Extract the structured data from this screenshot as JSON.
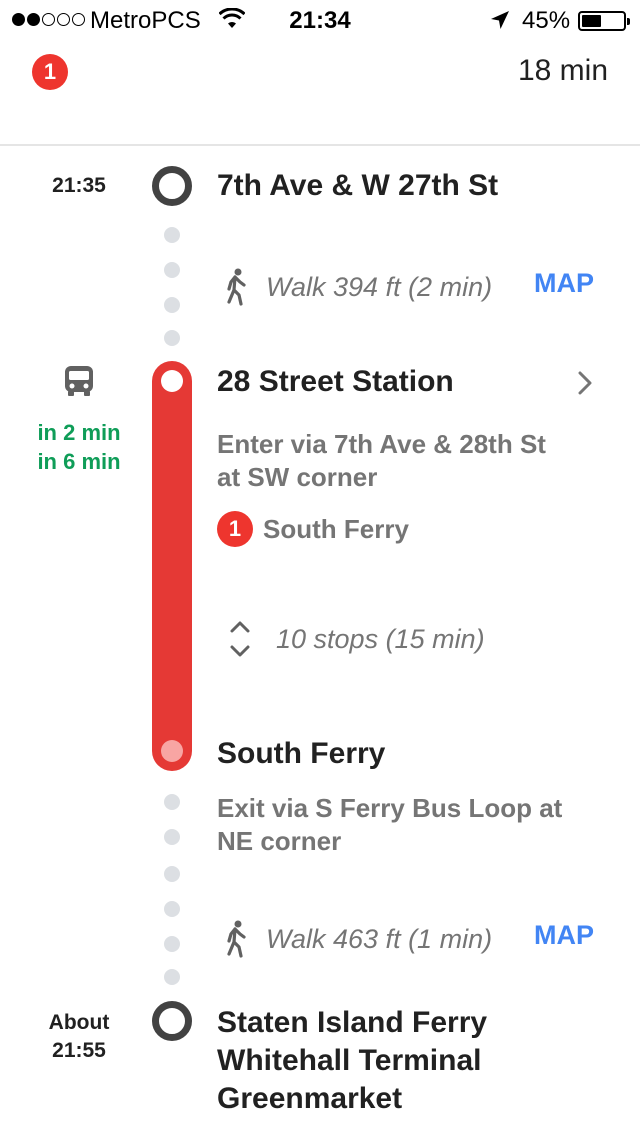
{
  "status_bar": {
    "carrier": "MetroPCS",
    "time": "21:34",
    "battery_percent": "45%",
    "battery_level": 0.45,
    "signal_bars": 2
  },
  "header": {
    "line_badge": "1",
    "duration": "18 min",
    "line_color": "#ee352e"
  },
  "steps": {
    "start": {
      "time": "21:35",
      "name": "7th Ave & W 27th St"
    },
    "walk1": {
      "text": "Walk 394 ft (2 min)",
      "map_label": "MAP"
    },
    "board": {
      "name": "28 Street Station",
      "departures": [
        "in 2 min",
        "in 6 min"
      ],
      "enter_line1": "Enter via 7th Ave & 28th St",
      "enter_line2": "at SW corner",
      "line_badge": "1",
      "headsign": "South Ferry",
      "stops": "10 stops (15 min)"
    },
    "alight": {
      "name": "South Ferry",
      "exit_line1": "Exit via S Ferry Bus Loop at",
      "exit_line2": "NE corner"
    },
    "walk2": {
      "text": "Walk 463 ft (1 min)",
      "map_label": "MAP"
    },
    "end": {
      "time_line1": "About",
      "time_line2": "21:55",
      "name_line1": "Staten Island Ferry",
      "name_line2": "Whitehall Terminal",
      "name_line3": "Greenmarket"
    }
  },
  "colors": {
    "route_red": "#e53935",
    "link_blue": "#4285f4",
    "realtime_green": "#0f9d58"
  },
  "icons": [
    "location-arrow-icon",
    "wifi-icon",
    "walk-icon",
    "bus-icon",
    "chevron-right-icon",
    "expand-icon"
  ]
}
